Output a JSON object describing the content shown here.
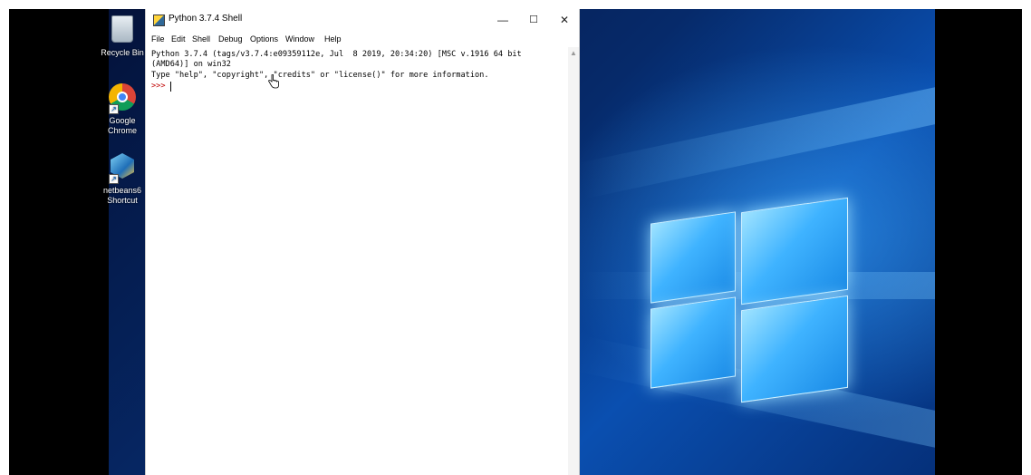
{
  "window": {
    "title": "Python 3.7.4 Shell",
    "controls": {
      "minimize": "—",
      "maximize": "☐",
      "close": "✕"
    }
  },
  "menu": [
    "File",
    "Edit",
    "Shell",
    "Debug",
    "Options",
    "Window",
    "Help"
  ],
  "console": {
    "line1": "Python 3.7.4 (tags/v3.7.4:e09359112e, Jul  8 2019, 20:34:20) [MSC v.1916 64 bit",
    "line2": "(AMD64)] on win32",
    "line3": "Type \"help\", \"copyright\", \"credits\" or \"license()\" for more information.",
    "prompt": ">>>"
  },
  "desktop_icons": [
    {
      "label": "Recycle Bin",
      "icon": "recycle-bin-icon"
    },
    {
      "label_line1": "Google",
      "label_line2": "Chrome",
      "icon": "chrome-icon"
    },
    {
      "label_line1": "netbeans6",
      "label_line2": "Shortcut",
      "icon": "netbeans-icon"
    }
  ],
  "colors": {
    "prompt": "#c00000",
    "desktop_blue": "#0a4fb0"
  }
}
